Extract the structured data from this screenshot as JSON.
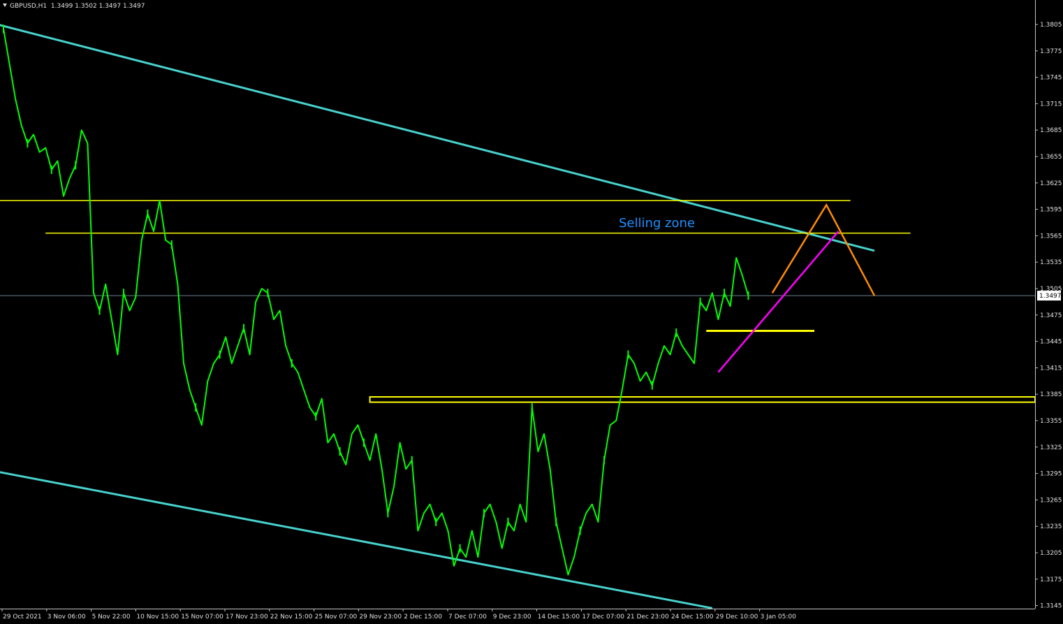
{
  "chart_data": {
    "type": "line",
    "symbol": "GBPUSD,H1",
    "ohlc_header": "1.3499 1.3502 1.3497 1.3497",
    "current_price_label": "1.3497",
    "current_price": 1.3497,
    "ylim": [
      1.313,
      1.383
    ],
    "y_ticks": [
      "1.3805",
      "1.3775",
      "1.3745",
      "1.3715",
      "1.3685",
      "1.3655",
      "1.3625",
      "1.3595",
      "1.3565",
      "1.3535",
      "1.3505",
      "1.3475",
      "1.3445",
      "1.3415",
      "1.3385",
      "1.3355",
      "1.3325",
      "1.3295",
      "1.3265",
      "1.3235",
      "1.3205",
      "1.3175",
      "1.3145"
    ],
    "x_ticks": [
      "29 Oct 2021",
      "3 Nov 06:00",
      "5 Nov 22:00",
      "10 Nov 15:00",
      "15 Nov 07:00",
      "17 Nov 23:00",
      "22 Nov 15:00",
      "25 Nov 07:00",
      "29 Nov 23:00",
      "2 Dec 15:00",
      "7 Dec 07:00",
      "9 Dec 23:00",
      "14 Dec 15:00",
      "17 Dec 07:00",
      "21 Dec 23:00",
      "24 Dec 15:00",
      "29 Dec 10:00",
      "3 Jan 05:00"
    ],
    "series": [
      {
        "color": "#00ff00",
        "points": [
          [
            0,
            1.38
          ],
          [
            1,
            1.376
          ],
          [
            2,
            1.372
          ],
          [
            3,
            1.369
          ],
          [
            4,
            1.367
          ],
          [
            5,
            1.368
          ],
          [
            6,
            1.366
          ],
          [
            7,
            1.3665
          ],
          [
            8,
            1.364
          ],
          [
            9,
            1.365
          ],
          [
            10,
            1.361
          ],
          [
            11,
            1.363
          ],
          [
            12,
            1.3645
          ],
          [
            13,
            1.3685
          ],
          [
            14,
            1.367
          ],
          [
            15,
            1.35
          ],
          [
            16,
            1.348
          ],
          [
            17,
            1.351
          ],
          [
            18,
            1.347
          ],
          [
            19,
            1.343
          ],
          [
            20,
            1.35
          ],
          [
            21,
            1.348
          ],
          [
            22,
            1.3495
          ],
          [
            23,
            1.356
          ],
          [
            24,
            1.359
          ],
          [
            25,
            1.357
          ],
          [
            26,
            1.3605
          ],
          [
            27,
            1.356
          ],
          [
            28,
            1.3555
          ],
          [
            29,
            1.351
          ],
          [
            30,
            1.342
          ],
          [
            31,
            1.339
          ],
          [
            32,
            1.337
          ],
          [
            33,
            1.335
          ],
          [
            34,
            1.34
          ],
          [
            35,
            1.342
          ],
          [
            36,
            1.343
          ],
          [
            37,
            1.345
          ],
          [
            38,
            1.342
          ],
          [
            39,
            1.344
          ],
          [
            40,
            1.346
          ],
          [
            41,
            1.343
          ],
          [
            42,
            1.349
          ],
          [
            43,
            1.3505
          ],
          [
            44,
            1.35
          ],
          [
            45,
            1.347
          ],
          [
            46,
            1.348
          ],
          [
            47,
            1.344
          ],
          [
            48,
            1.342
          ],
          [
            49,
            1.341
          ],
          [
            50,
            1.339
          ],
          [
            51,
            1.337
          ],
          [
            52,
            1.336
          ],
          [
            53,
            1.338
          ],
          [
            54,
            1.333
          ],
          [
            55,
            1.334
          ],
          [
            56,
            1.332
          ],
          [
            57,
            1.3305
          ],
          [
            58,
            1.334
          ],
          [
            59,
            1.335
          ],
          [
            60,
            1.333
          ],
          [
            61,
            1.331
          ],
          [
            62,
            1.334
          ],
          [
            63,
            1.33
          ],
          [
            64,
            1.325
          ],
          [
            65,
            1.328
          ],
          [
            66,
            1.333
          ],
          [
            67,
            1.33
          ],
          [
            68,
            1.331
          ],
          [
            69,
            1.323
          ],
          [
            70,
            1.325
          ],
          [
            71,
            1.326
          ],
          [
            72,
            1.324
          ],
          [
            73,
            1.325
          ],
          [
            74,
            1.323
          ],
          [
            75,
            1.319
          ],
          [
            76,
            1.321
          ],
          [
            77,
            1.32
          ],
          [
            78,
            1.323
          ],
          [
            79,
            1.32
          ],
          [
            80,
            1.325
          ],
          [
            81,
            1.326
          ],
          [
            82,
            1.324
          ],
          [
            83,
            1.321
          ],
          [
            84,
            1.324
          ],
          [
            85,
            1.323
          ],
          [
            86,
            1.326
          ],
          [
            87,
            1.324
          ],
          [
            88,
            1.337
          ],
          [
            89,
            1.332
          ],
          [
            90,
            1.334
          ],
          [
            91,
            1.33
          ],
          [
            92,
            1.324
          ],
          [
            93,
            1.321
          ],
          [
            94,
            1.318
          ],
          [
            95,
            1.32
          ],
          [
            96,
            1.323
          ],
          [
            97,
            1.325
          ],
          [
            98,
            1.326
          ],
          [
            99,
            1.324
          ],
          [
            100,
            1.331
          ],
          [
            101,
            1.335
          ],
          [
            102,
            1.3355
          ],
          [
            103,
            1.339
          ],
          [
            104,
            1.343
          ],
          [
            105,
            1.342
          ],
          [
            106,
            1.34
          ],
          [
            107,
            1.341
          ],
          [
            108,
            1.3395
          ],
          [
            109,
            1.342
          ],
          [
            110,
            1.344
          ],
          [
            111,
            1.343
          ],
          [
            112,
            1.3455
          ],
          [
            113,
            1.344
          ],
          [
            114,
            1.343
          ],
          [
            115,
            1.342
          ],
          [
            116,
            1.349
          ],
          [
            117,
            1.348
          ],
          [
            118,
            1.35
          ],
          [
            119,
            1.347
          ],
          [
            120,
            1.35
          ],
          [
            121,
            1.3485
          ],
          [
            122,
            1.354
          ],
          [
            123,
            1.352
          ],
          [
            124,
            1.3497
          ]
        ]
      }
    ],
    "annotations": [
      {
        "text": "Selling zone",
        "color": "#1e90ff"
      }
    ],
    "trendlines": {
      "channel_color": "#48d1cc",
      "upper_channel": {
        "from": [
          -1,
          1.3805
        ],
        "to": [
          145,
          1.3548
        ]
      },
      "lower_channel": {
        "from": [
          -1,
          1.3297
        ],
        "to": [
          118,
          1.3142
        ]
      },
      "zone_color": "#ffff00",
      "selling_zone_top": {
        "price": 1.3605,
        "from_x": -1,
        "to_x": 141
      },
      "selling_zone_bottom": {
        "price": 1.3568,
        "from_x": 7,
        "to_x": 151
      },
      "support_line": {
        "price": 1.3457,
        "from_x": 117,
        "to_x": 135
      },
      "support_zone": {
        "top": 1.3382,
        "bottom": 1.3376,
        "from_x": 61,
        "to_x": 175
      },
      "magenta_trendline": {
        "color": "#ff00ff",
        "from": [
          119,
          1.341
        ],
        "to": [
          139,
          1.357
        ]
      },
      "projection": {
        "color": "#ff8c00",
        "points": [
          [
            128,
            1.35
          ],
          [
            137,
            1.36
          ],
          [
            145,
            1.3497
          ]
        ]
      },
      "current_price_line_color": "#708090"
    }
  }
}
